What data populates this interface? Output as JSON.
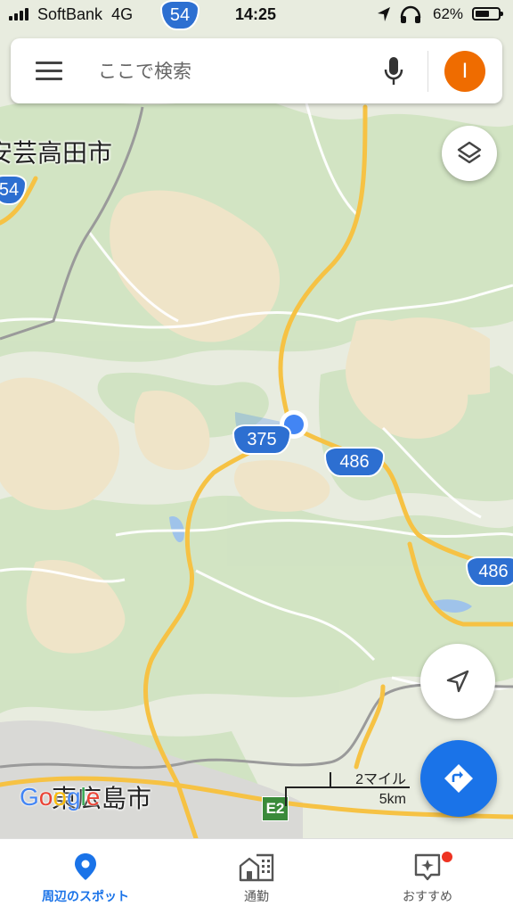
{
  "status_bar": {
    "carrier": "SoftBank",
    "network": "4G",
    "time": "14:25",
    "battery_percent": "62%",
    "battery_level": 0.62
  },
  "search": {
    "placeholder": "ここで検索",
    "avatar_initial": "I",
    "icons": [
      "menu-icon",
      "mic-icon"
    ]
  },
  "map": {
    "places": [
      {
        "id": "higashihiroshima",
        "label": "東広島市"
      },
      {
        "id": "akitakata",
        "label": "安芸高田市"
      }
    ],
    "routes": [
      "375",
      "486",
      "486",
      "54",
      "54"
    ],
    "expressway": "E2",
    "scale": {
      "top": "2マイル",
      "bottom": "5km"
    },
    "logo": "Google",
    "colors": {
      "road": "#f6c244",
      "route_shield": "#2d6fd1",
      "location": "#4285f4",
      "land": "#e8ecdf",
      "forest": "#cfe3c0",
      "highland": "#efe4c8"
    }
  },
  "buttons": {
    "layers": "layers-icon",
    "my_location": "navigation-arrow-icon",
    "directions": "directions-icon"
  },
  "bottom_nav": [
    {
      "label": "周辺のスポット",
      "icon": "location-pin-icon",
      "active": true
    },
    {
      "label": "通勤",
      "icon": "commute-buildings-icon",
      "active": false
    },
    {
      "label": "おすすめ",
      "icon": "sparkle-icon",
      "active": false,
      "badge": true
    }
  ]
}
